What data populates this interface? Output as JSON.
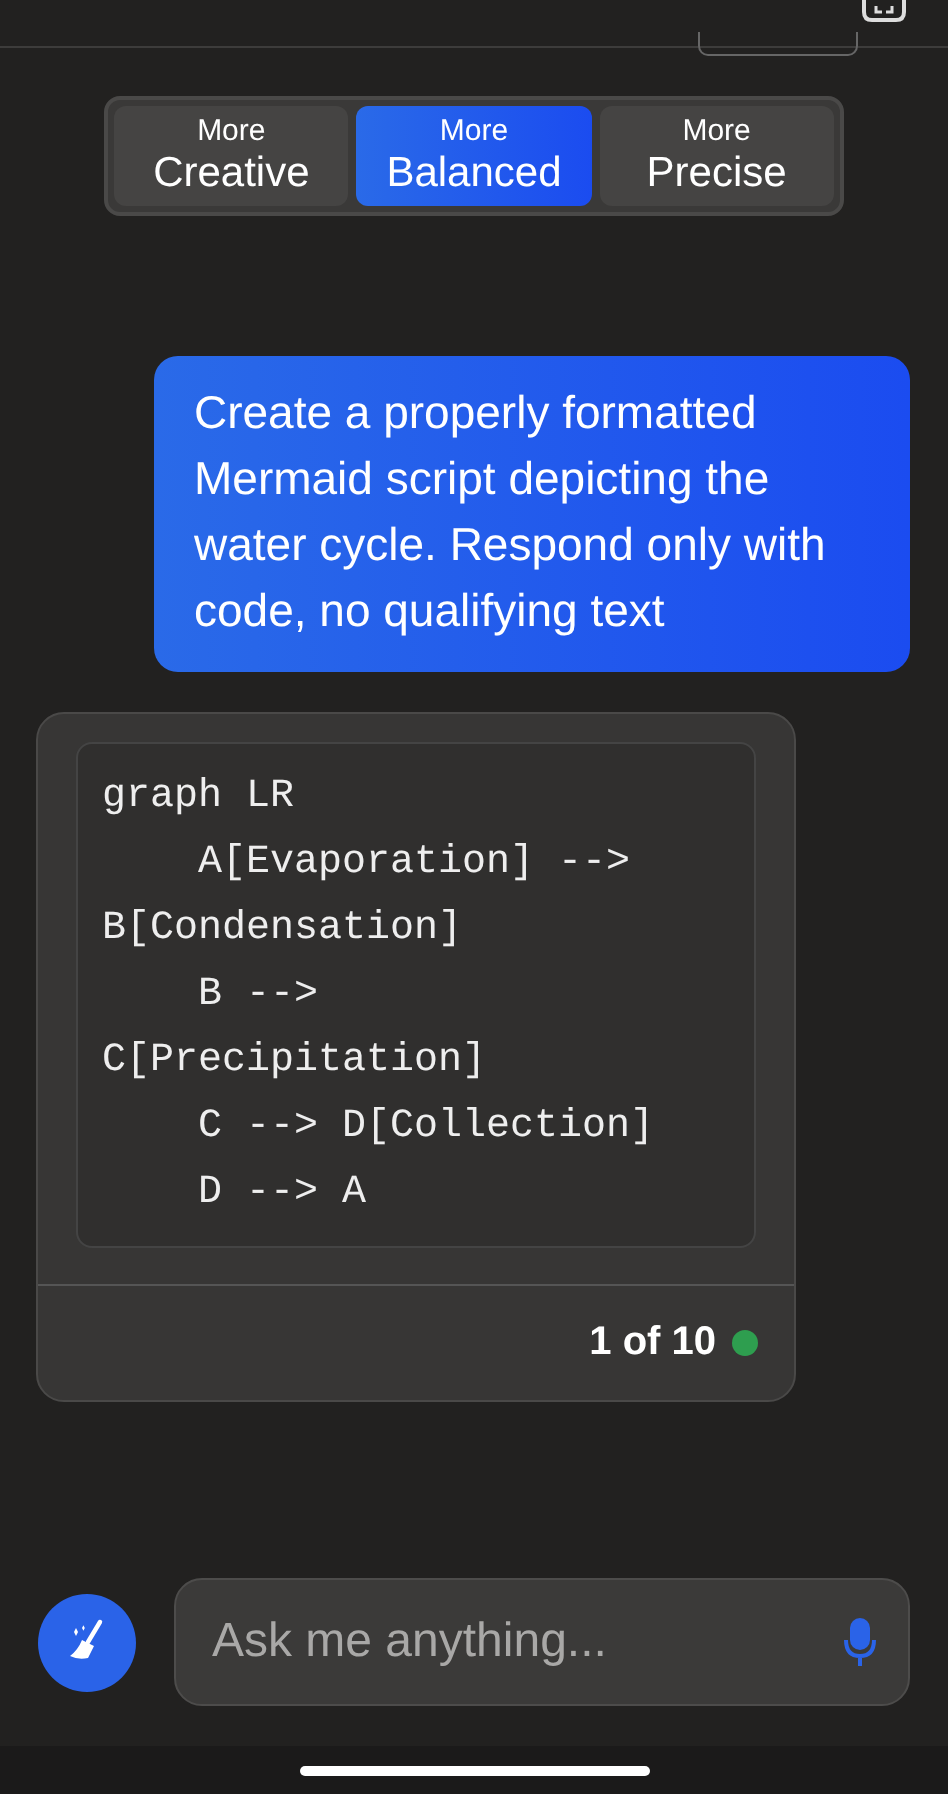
{
  "modes": [
    {
      "prefix": "More",
      "label": "Creative",
      "selected": false
    },
    {
      "prefix": "More",
      "label": "Balanced",
      "selected": true
    },
    {
      "prefix": "More",
      "label": "Precise",
      "selected": false
    }
  ],
  "messages": [
    {
      "kind": "user",
      "text": "Create a properly formatted Mermaid script depicting the water cycle. Respond only with code, no qualifying text"
    },
    {
      "kind": "bot",
      "code_lines": [
        "graph LR",
        "    A[Evaporation] -->",
        "B[Condensation]",
        "    B -->",
        "C[Precipitation]",
        "    C --> D[Collection]",
        "    D --> A"
      ],
      "counter": "1 of 10",
      "color": "#2e9e4f"
    }
  ],
  "composer": {
    "placeholder": "Ask me anything..."
  }
}
